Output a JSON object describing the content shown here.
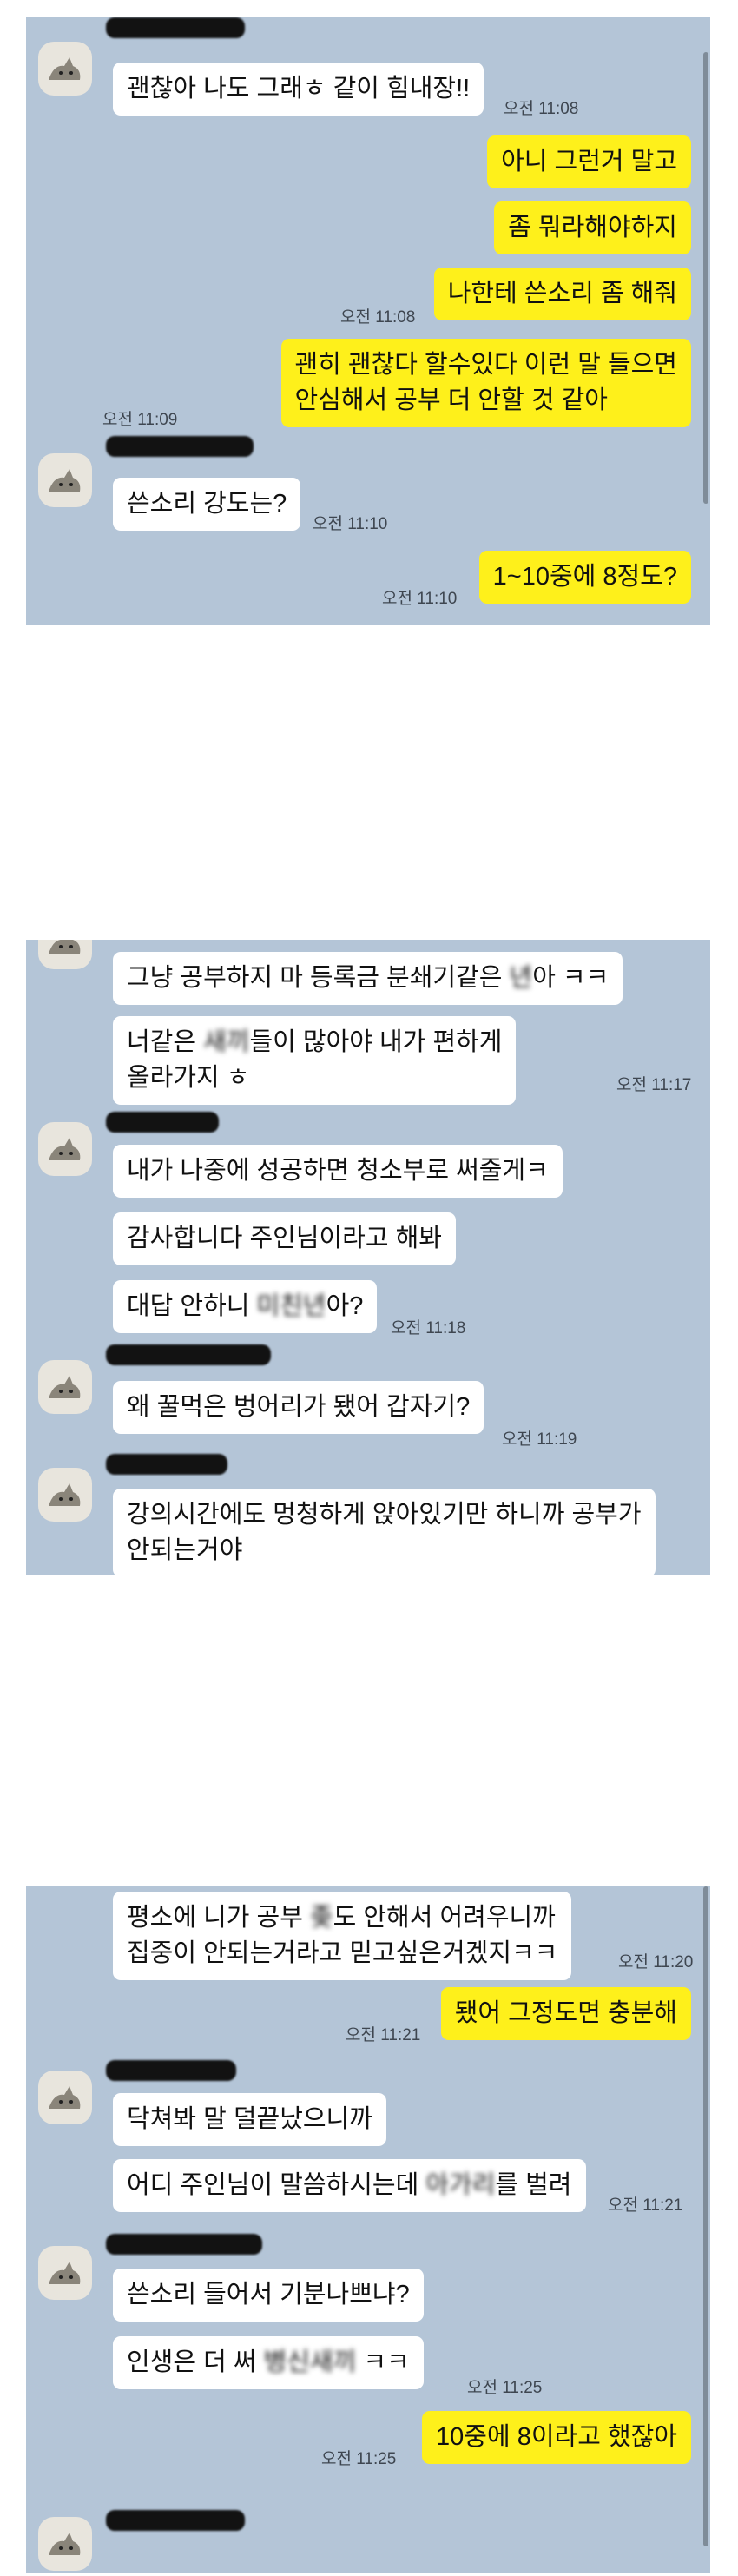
{
  "panels": [
    {
      "messages": [
        {
          "text": "괜찮아 나도 그래ㅎ 같이 힘내장!!",
          "time": "오전 11:08"
        },
        {
          "text": "아니 그런거 말고"
        },
        {
          "text": "좀 뭐라해야하지"
        },
        {
          "text": "나한테 쓴소리 좀 해줘",
          "time": "오전 11:08"
        },
        {
          "text": "괜히 괜찮다 할수있다 이런 말 들으면\n안심해서 공부 더 안할 것 같아",
          "time": "오전 11:09"
        },
        {
          "text": "쓴소리 강도는?",
          "time": "오전 11:10"
        },
        {
          "text": "1~10중에 8정도?",
          "time": "오전 11:10"
        }
      ]
    },
    {
      "messages": [
        {
          "text_a": "그냥 공부하지 마 등록금 분쇄기같은 ",
          "text_blur": "년",
          "text_b": "아 ㅋㅋ"
        },
        {
          "text_a": "너같은 ",
          "text_blur": "새끼",
          "text_b": "들이 많아야 내가 편하게\n올라가지 ㅎ",
          "time": "오전 11:17"
        },
        {
          "text": "내가 나중에 성공하면 청소부로 써줄게ㅋ"
        },
        {
          "text": "감사합니다 주인님이라고 해봐"
        },
        {
          "text_a": "대답 안하니 ",
          "text_blur": "미친년",
          "text_b": "아?",
          "time": "오전 11:18"
        },
        {
          "text": "왜 꿀먹은 벙어리가 됐어 갑자기?",
          "time": "오전 11:19"
        },
        {
          "text": "강의시간에도 멍청하게 앉아있기만 하니까 공부가\n안되는거야"
        }
      ]
    },
    {
      "messages": [
        {
          "text_a": "평소에 니가 공부 ",
          "text_blur": "좆",
          "text_b": "도 안해서 어려우니까\n집중이 안되는거라고 믿고싶은거겠지ㅋㅋ",
          "time": "오전 11:20"
        },
        {
          "text": "됐어 그정도면 충분해",
          "time": "오전 11:21"
        },
        {
          "text": "닥쳐봐 말 덜끝났으니까"
        },
        {
          "text_a": "어디 주인님이 말씀하시는데 ",
          "text_blur": "아가리",
          "text_b": "를 벌려",
          "time": "오전 11:21"
        },
        {
          "text": "쓴소리 들어서 기분나쁘냐?"
        },
        {
          "text_a": "인생은 더 써 ",
          "text_blur": "병신새끼",
          "text_b": " ㅋㅋ",
          "time": "오전 11:25"
        },
        {
          "text": "10중에 8이라고 했잖아",
          "time": "오전 11:25"
        }
      ]
    }
  ],
  "colors": {
    "chat_bg": "#b4c5d7",
    "my_bubble": "#fef01b",
    "their_bubble": "#ffffff"
  },
  "icons": {
    "avatar": "cat-avatar-icon"
  }
}
